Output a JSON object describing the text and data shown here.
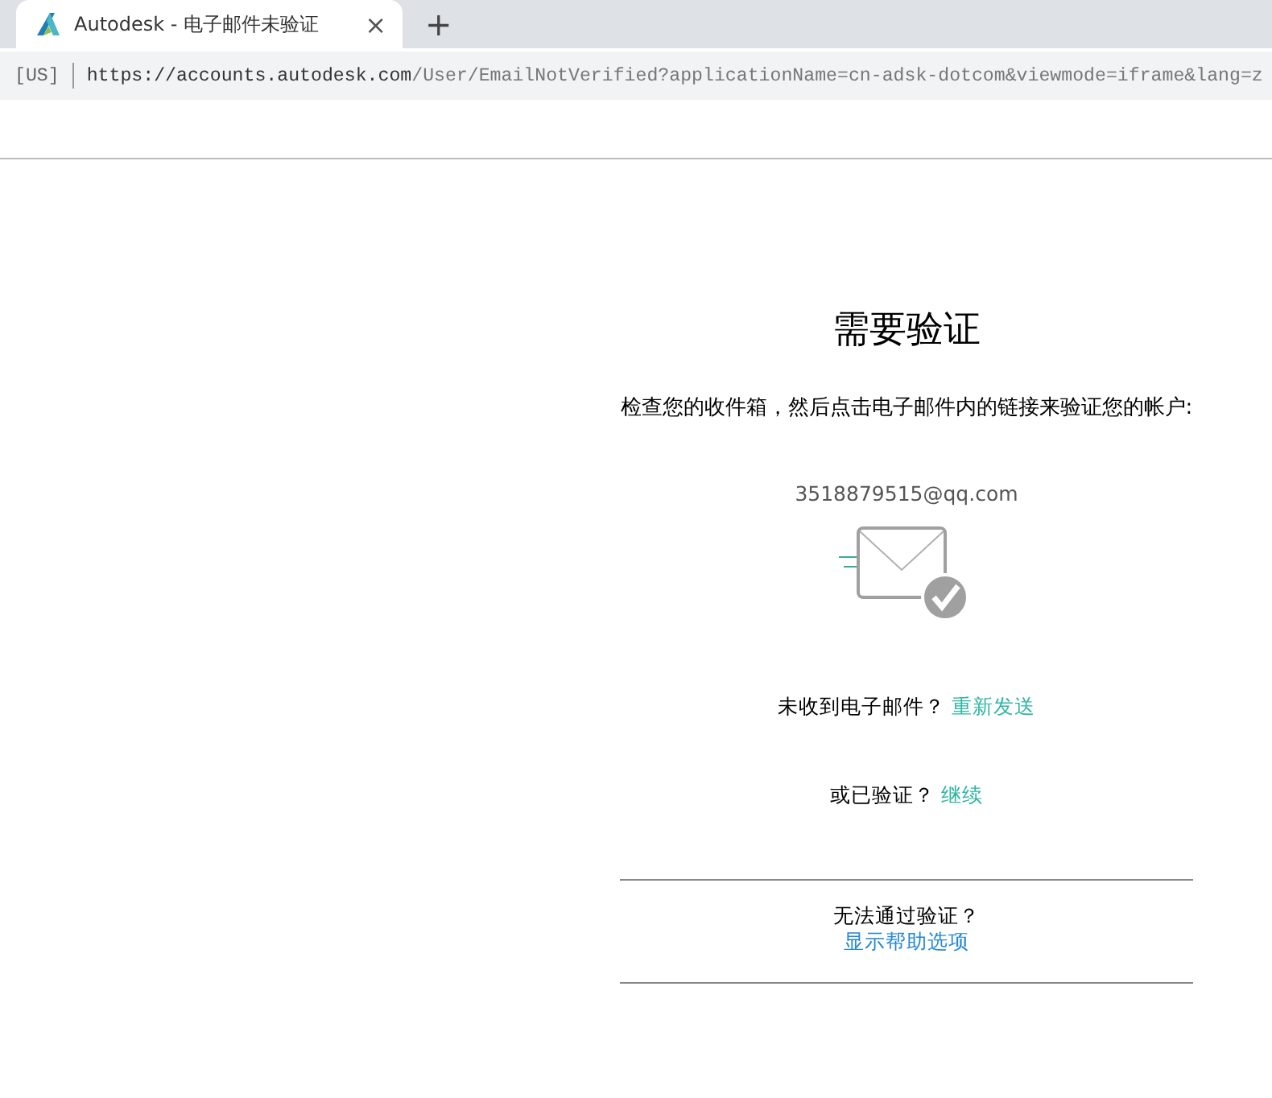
{
  "browser": {
    "tab": {
      "title": "Autodesk - 电子邮件未验证",
      "selected": true
    },
    "new_tab": "+",
    "close": "×",
    "address": {
      "region": "[US]",
      "host": "https://accounts.autodesk.com",
      "path": "/User/EmailNotVerified?applicationName=cn-adsk-dotcom&viewmode=iframe&lang=z"
    }
  },
  "page": {
    "title": "需要验证",
    "message": "检查您的收件箱，然后点击电子邮件内的链接来验证您的帐户:",
    "email": "3518879515@qq.com",
    "resend": {
      "text": "未收到电子邮件？",
      "link": "重新发送"
    },
    "verified": {
      "text": "或已验证？",
      "link": "继续"
    },
    "help": {
      "text": "无法通过验证？",
      "link": "显示帮助选项"
    }
  }
}
